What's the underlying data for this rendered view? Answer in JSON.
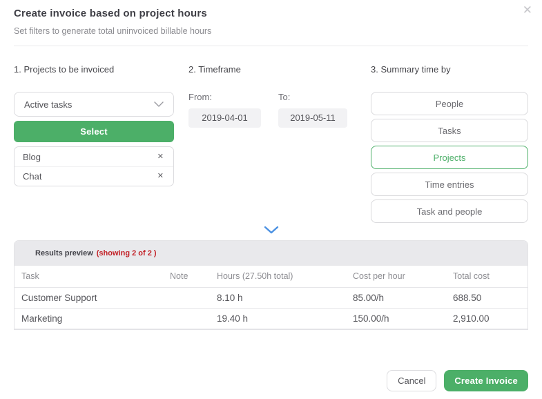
{
  "dialog": {
    "title": "Create invoice based on project hours",
    "subtitle": "Set filters to generate total uninvoiced billable hours",
    "close_glyph": "✕"
  },
  "projects": {
    "heading": "1. Projects to be invoiced",
    "filter": {
      "selected": "Active tasks"
    },
    "select_button": "Select",
    "selected_items": [
      {
        "name": "Blog",
        "remove_glyph": "✕"
      },
      {
        "name": "Chat",
        "remove_glyph": "✕"
      }
    ]
  },
  "timeframe": {
    "heading": "2. Timeframe",
    "from": {
      "label": "From:",
      "value": "2019-04-01"
    },
    "to": {
      "label": "To:",
      "value": "2019-05-11"
    }
  },
  "summary": {
    "heading": "3. Summary time by",
    "options": [
      {
        "label": "People",
        "selected": false
      },
      {
        "label": "Tasks",
        "selected": false
      },
      {
        "label": "Projects",
        "selected": true
      },
      {
        "label": "Time entries",
        "selected": false
      },
      {
        "label": "Task and people",
        "selected": false
      }
    ]
  },
  "results": {
    "title": "Results preview",
    "showing": "(showing 2 of 2 )",
    "columns": [
      "Task",
      "Note",
      "Hours (27.50h total)",
      "Cost per hour",
      "Total cost"
    ],
    "rows": [
      {
        "task": "Customer Support",
        "note": "",
        "hours": "8.10 h",
        "cost_per_hour": "85.00/h",
        "total_cost": "688.50"
      },
      {
        "task": "Marketing",
        "note": "",
        "hours": "19.40 h",
        "cost_per_hour": "150.00/h",
        "total_cost": "2,910.00"
      }
    ]
  },
  "footer": {
    "cancel_label": "Cancel",
    "create_label": "Create Invoice"
  },
  "colors": {
    "accent_green": "#4caf68",
    "alert_red": "#c22026",
    "chevron_blue": "#4a90e2"
  }
}
